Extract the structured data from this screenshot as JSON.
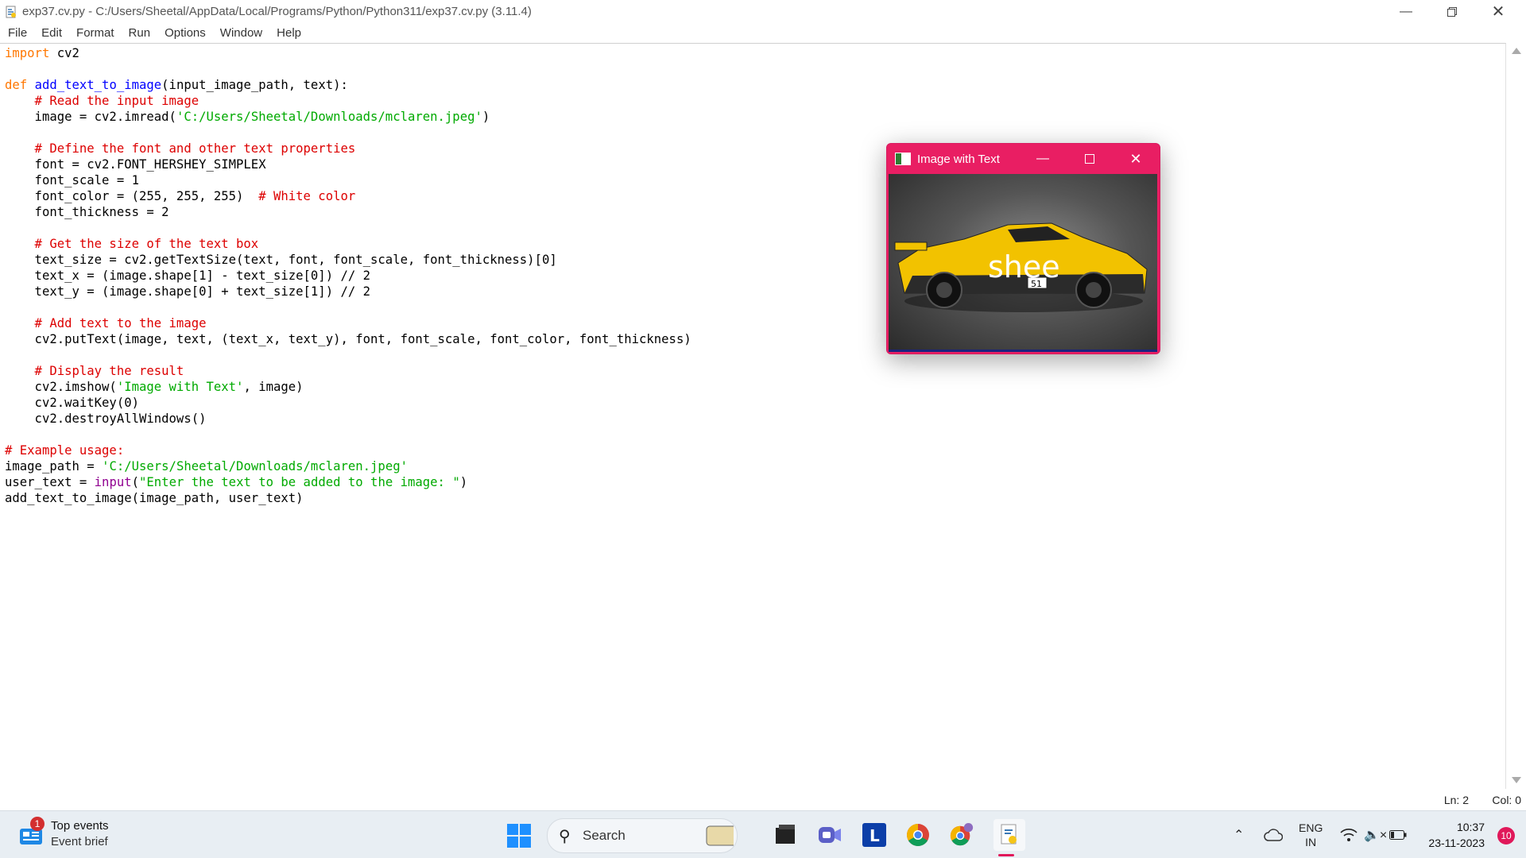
{
  "window": {
    "title": "exp37.cv.py - C:/Users/Sheetal/AppData/Local/Programs/Python/Python311/exp37.cv.py (3.11.4)",
    "minimize_icon": "minimize-icon",
    "restore_icon": "restore-icon",
    "close_icon": "close-icon"
  },
  "menu": {
    "items": [
      "File",
      "Edit",
      "Format",
      "Run",
      "Options",
      "Window",
      "Help"
    ]
  },
  "code": {
    "l1a": "import",
    "l1b": " cv2",
    "l3a": "def",
    "l3b": "add_text_to_image",
    "l3c": "(input_image_path, text):",
    "l4": "    # Read the input image",
    "l5a": "    image = cv2.imread(",
    "l5b": "'C:/Users/Sheetal/Downloads/mclaren.jpeg'",
    "l5c": ")",
    "l7": "    # Define the font and other text properties",
    "l8": "    font = cv2.FONT_HERSHEY_SIMPLEX",
    "l9": "    font_scale = 1",
    "l10a": "    font_color = (255, 255, 255)  ",
    "l10b": "# White color",
    "l11": "    font_thickness = 2",
    "l13": "    # Get the size of the text box",
    "l14": "    text_size = cv2.getTextSize(text, font, font_scale, font_thickness)[0]",
    "l15": "    text_x = (image.shape[1] - text_size[0]) // 2",
    "l16": "    text_y = (image.shape[0] + text_size[1]) // 2",
    "l18": "    # Add text to the image",
    "l19": "    cv2.putText(image, text, (text_x, text_y), font, font_scale, font_color, font_thickness)",
    "l21": "    # Display the result",
    "l22a": "    cv2.imshow(",
    "l22b": "'Image with Text'",
    "l22c": ", image)",
    "l23": "    cv2.waitKey(0)",
    "l24": "    cv2.destroyAllWindows()",
    "l26": "# Example usage:",
    "l27a": "image_path = ",
    "l27b": "'C:/Users/Sheetal/Downloads/mclaren.jpeg'",
    "l28a": "user_text = ",
    "l28b": "input",
    "l28c": "(",
    "l28d": "\"Enter the text to be added to the image: \"",
    "l28e": ")",
    "l29": "add_text_to_image(image_path, user_text)"
  },
  "status": {
    "line": "Ln: 2",
    "col": "Col: 0"
  },
  "image_window": {
    "title": "Image with Text",
    "overlay_text": "shee",
    "accent_color": "#e91e63"
  },
  "taskbar": {
    "news_title": "Top events",
    "news_sub": "Event brief",
    "news_badge": "1",
    "search_placeholder": "Search",
    "apps": [
      "file-explorer-icon",
      "teams-meet-icon",
      "l-app-icon",
      "chrome-icon",
      "chrome-profile-icon",
      "python-idle-icon"
    ],
    "lang_top": "ENG",
    "lang_bottom": "IN",
    "time": "10:37",
    "date": "23-11-2023",
    "notifications": "10"
  }
}
